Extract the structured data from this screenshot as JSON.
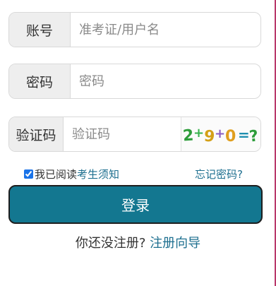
{
  "form": {
    "account": {
      "label": "账号",
      "placeholder": "准考证/用户名"
    },
    "password": {
      "label": "密码",
      "placeholder": "密码"
    },
    "captcha": {
      "label": "验证码",
      "placeholder": "验证码",
      "image_text": "2+9+0=?"
    }
  },
  "options": {
    "agree_checked": true,
    "agree_prefix": "我已阅读",
    "agree_link": "考生须知",
    "forgot_link": "忘记密码?"
  },
  "login_button": "登录",
  "register": {
    "prompt": "你还没注册?",
    "link": "注册向导"
  },
  "colors": {
    "primary": "#137790",
    "link": "#1d6f8f"
  }
}
